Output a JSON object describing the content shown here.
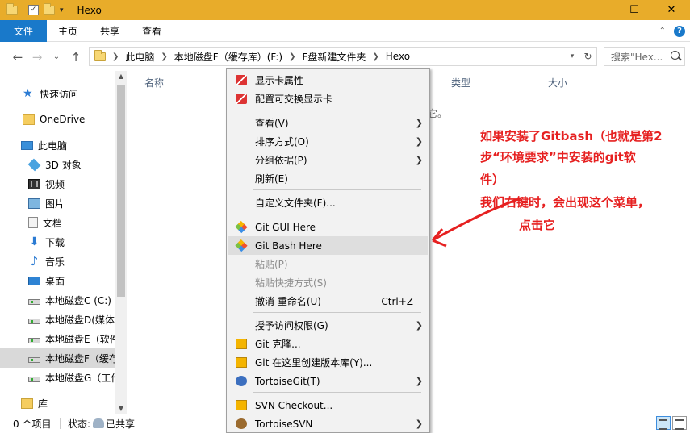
{
  "window": {
    "title": "Hexo",
    "minimize_glyph": "–",
    "maximize_glyph": "☐",
    "close_glyph": "✕"
  },
  "ribbon": {
    "tabs": [
      "文件",
      "主页",
      "共享",
      "查看"
    ],
    "help_glyph": "?",
    "collapse_glyph": "⌃"
  },
  "nav": {
    "back": "←",
    "forward": "→",
    "recent": "⌄",
    "up": "↑"
  },
  "address": {
    "breadcrumbs": [
      "此电脑",
      "本地磁盘F（缓存库）(F:)",
      "F盘新建文件夹",
      "Hexo"
    ],
    "refresh_glyph": "↻",
    "search_placeholder": "搜索\"Hex..."
  },
  "sidebar": {
    "items": [
      {
        "label": "快速访问",
        "icon": "star-icon"
      },
      {
        "label": "OneDrive",
        "icon": "onedrive-folder-icon"
      },
      {
        "label": "此电脑",
        "icon": "this-pc-icon"
      },
      {
        "label": "3D 对象",
        "icon": "3d-objects-icon"
      },
      {
        "label": "视频",
        "icon": "video-icon"
      },
      {
        "label": "图片",
        "icon": "pictures-icon"
      },
      {
        "label": "文档",
        "icon": "documents-icon"
      },
      {
        "label": "下载",
        "icon": "downloads-icon"
      },
      {
        "label": "音乐",
        "icon": "music-icon"
      },
      {
        "label": "桌面",
        "icon": "desktop-icon"
      },
      {
        "label": "本地磁盘C (C:)",
        "icon": "drive-icon"
      },
      {
        "label": "本地磁盘D(媒体",
        "icon": "drive-icon"
      },
      {
        "label": "本地磁盘E（软件",
        "icon": "drive-icon"
      },
      {
        "label": "本地磁盘F（缓存",
        "icon": "drive-icon"
      },
      {
        "label": "本地磁盘G（工作",
        "icon": "drive-icon"
      },
      {
        "label": "库",
        "icon": "library-icon"
      }
    ],
    "selected_index": 13
  },
  "content": {
    "columns": [
      "名称",
      "类型",
      "大小"
    ],
    "empty_message": "它。"
  },
  "annotation": {
    "lines": [
      "如果安装了Gitbash（也就是第2",
      "步“环境要求”中安装的git软",
      "件）",
      "我们右键时，会出现这个菜单，",
      "点击它"
    ],
    "color": "#e62020"
  },
  "context_menu": {
    "items": [
      {
        "label": "显示卡属性",
        "icon": "graphics-card-icon"
      },
      {
        "label": "配置可交换显示卡",
        "icon": "graphics-card-icon"
      },
      {
        "label": "查看(V)",
        "submenu": true
      },
      {
        "label": "排序方式(O)",
        "submenu": true
      },
      {
        "label": "分组依据(P)",
        "submenu": true
      },
      {
        "label": "刷新(E)"
      },
      {
        "label": "自定义文件夹(F)..."
      },
      {
        "label": "Git GUI Here",
        "icon": "git-icon"
      },
      {
        "label": "Git Bash Here",
        "icon": "git-icon",
        "highlighted": true
      },
      {
        "label": "粘贴(P)",
        "disabled": true
      },
      {
        "label": "粘贴快捷方式(S)",
        "disabled": true
      },
      {
        "label": "撤消 重命名(U)",
        "shortcut": "Ctrl+Z"
      },
      {
        "label": "授予访问权限(G)",
        "submenu": true
      },
      {
        "label": "Git 克隆...",
        "icon": "tortoisegit-icon"
      },
      {
        "label": "Git 在这里创建版本库(Y)...",
        "icon": "tortoisegit-icon"
      },
      {
        "label": "TortoiseGit(T)",
        "icon": "tortoisegit-icon",
        "submenu": true
      },
      {
        "label": "SVN Checkout...",
        "icon": "tortoisesvn-icon"
      },
      {
        "label": "TortoiseSVN",
        "icon": "tortoisesvn-icon",
        "submenu": true
      }
    ],
    "submenu_glyph": "❯"
  },
  "status": {
    "item_count": "0 个项目",
    "state_label": "状态:",
    "state_value": "已共享"
  }
}
